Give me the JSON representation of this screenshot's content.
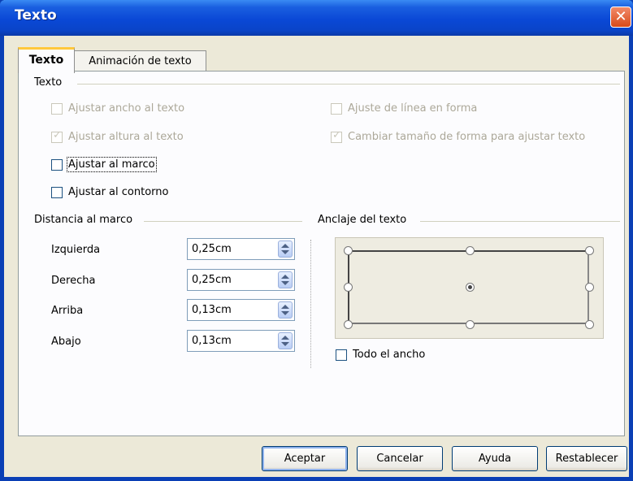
{
  "window": {
    "title": "Texto"
  },
  "tabs": [
    {
      "label": "Texto",
      "active": true
    },
    {
      "label": "Animación de texto",
      "active": false
    }
  ],
  "text_group": {
    "title": "Texto",
    "options": [
      {
        "label": "Ajustar ancho al texto",
        "checked": false,
        "enabled": false
      },
      {
        "label": "Ajuste de línea en forma",
        "checked": false,
        "enabled": false
      },
      {
        "label": "Ajustar altura al texto",
        "checked": true,
        "enabled": false
      },
      {
        "label": "Cambiar tamaño de forma para ajustar texto",
        "checked": true,
        "enabled": false
      },
      {
        "label": "Ajustar al marco",
        "checked": false,
        "enabled": true,
        "focused": true
      },
      {
        "label": "Ajustar al contorno",
        "checked": false,
        "enabled": true
      }
    ]
  },
  "distance_group": {
    "title": "Distancia al marco",
    "fields": [
      {
        "label": "Izquierda",
        "value": "0,25cm"
      },
      {
        "label": "Derecha",
        "value": "0,25cm"
      },
      {
        "label": "Arriba",
        "value": "0,13cm"
      },
      {
        "label": "Abajo",
        "value": "0,13cm"
      }
    ]
  },
  "anchor_group": {
    "title": "Anclaje del texto",
    "selected": "center",
    "full_width": {
      "label": "Todo el ancho",
      "checked": false
    }
  },
  "buttons": {
    "ok": "Aceptar",
    "cancel": "Cancelar",
    "help": "Ayuda",
    "reset": "Restablecer"
  }
}
